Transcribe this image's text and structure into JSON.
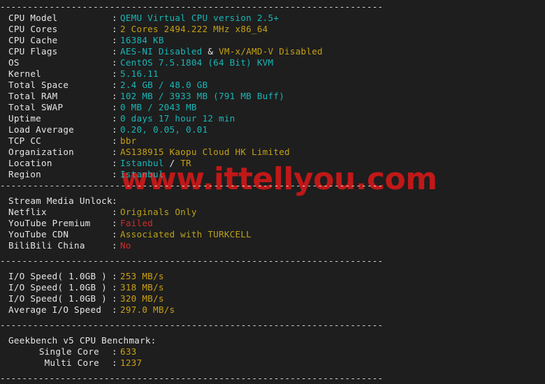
{
  "terminal": {
    "background_color": "#1e1e1e",
    "separator": "----------------------------------------------------------------------",
    "colon": ":"
  },
  "colors": {
    "cyan": "#19b6b6",
    "yellow": "#c5a015",
    "red": "#d02b2b",
    "white": "#e6e6e6",
    "watermark_red": "#c01818"
  },
  "watermark": {
    "text": "www.ittellyou.com"
  },
  "system_info": [
    {
      "label": "CPU Model",
      "value": "QEMU Virtual CPU version 2.5+"
    },
    {
      "label": "CPU Cores",
      "value": "2 Cores 2494.222 MHz x86_64"
    },
    {
      "label": "CPU Cache",
      "value": "16384 KB"
    },
    {
      "label": "CPU Flags",
      "value_part1": "AES-NI Disabled",
      "value_sep": " & ",
      "value_part2": "VM-x/AMD-V Disabled"
    },
    {
      "label": "OS",
      "value": "CentOS 7.5.1804 (64 Bit) KVM"
    },
    {
      "label": "Kernel",
      "value": "5.16.11"
    },
    {
      "label": "Total Space",
      "value": "2.4 GB / 48.0 GB"
    },
    {
      "label": "Total RAM",
      "value": "102 MB / 3933 MB (791 MB Buff)"
    },
    {
      "label": "Total SWAP",
      "value": "0 MB / 2043 MB"
    },
    {
      "label": "Uptime",
      "value": "0 days 17 hour 12 min"
    },
    {
      "label": "Load Average",
      "value": "0.20, 0.05, 0.01"
    },
    {
      "label": "TCP CC",
      "value": "bbr"
    },
    {
      "label": "Organization",
      "value": "AS138915 Kaopu Cloud HK Limited"
    },
    {
      "label": "Location",
      "value_city": "Istanbul",
      "value_slash": " / ",
      "value_country": "TR"
    },
    {
      "label": "Region",
      "value": "Istanbul"
    }
  ],
  "stream_media": {
    "header_label": "Stream Media Unlock",
    "header_value": "",
    "rows": [
      {
        "label": "Netflix",
        "value": "Originals Only"
      },
      {
        "label": "YouTube Premium",
        "value": "Failed"
      },
      {
        "label": "YouTube CDN",
        "value": "Associated with TURKCELL"
      },
      {
        "label": "BiliBili China",
        "value": "No"
      }
    ]
  },
  "io_speed": {
    "rows": [
      {
        "label": "I/O Speed( 1.0GB )",
        "value": "253 MB/s"
      },
      {
        "label": "I/O Speed( 1.0GB )",
        "value": "318 MB/s"
      },
      {
        "label": "I/O Speed( 1.0GB )",
        "value": "320 MB/s"
      },
      {
        "label": "Average I/O Speed",
        "value": "297.0 MB/s"
      }
    ]
  },
  "geekbench": {
    "title": "Geekbench v5 CPU Benchmark:",
    "rows": [
      {
        "label": "Single Core",
        "value": "633"
      },
      {
        "label": "Multi Core",
        "value": "1237"
      }
    ]
  }
}
